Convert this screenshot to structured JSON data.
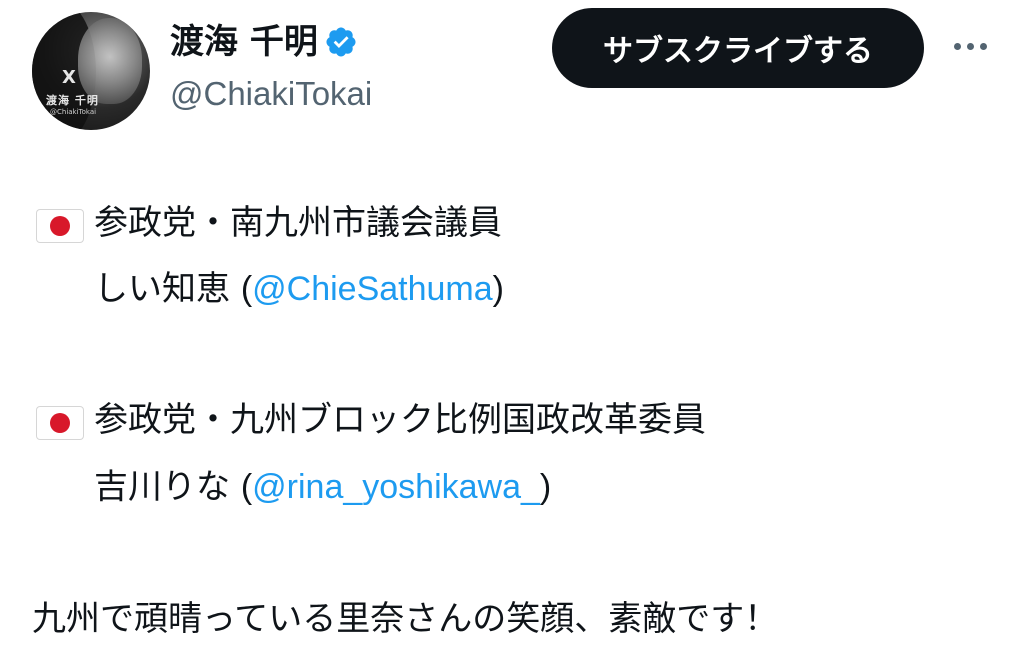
{
  "header": {
    "display_name": "渡海 千明",
    "handle": "@ChiakiTokai",
    "subscribe_label": "サブスクライブする",
    "avatar": {
      "x_mark": "X",
      "name": "渡海 千明",
      "handle": "@ChiakiTokai"
    },
    "verified_color": "#1d9bf0"
  },
  "tweet": {
    "block1": {
      "flag_icon": "japan-flag",
      "line1": "参政党・南九州市議会議員",
      "line2_name": "しい知恵 ",
      "line2_open": "(",
      "line2_mention": "@ChieSathuma",
      "line2_close": ")"
    },
    "block2": {
      "flag_icon": "japan-flag",
      "line1": "参政党・九州ブロック比例国政改革委員",
      "line2_name": "吉川りな ",
      "line2_open": "(",
      "line2_mention": "@rina_yoshikawa_",
      "line2_close": ")"
    },
    "closing": "九州で頑晴っている里奈さんの笑顔、素敵です！"
  },
  "colors": {
    "link": "#1d9bf0",
    "text": "#0f1419",
    "muted": "#536471",
    "button_bg": "#0f1419"
  }
}
